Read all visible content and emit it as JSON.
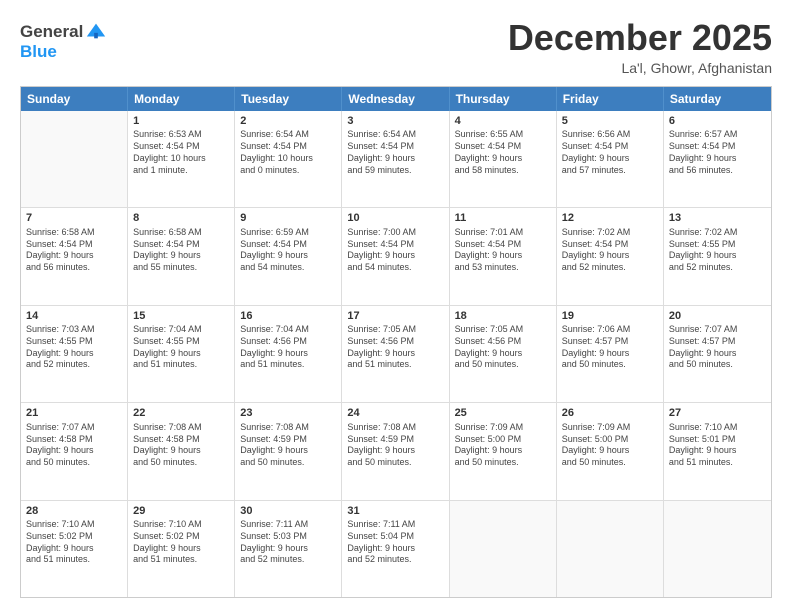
{
  "logo": {
    "general": "General",
    "blue": "Blue"
  },
  "header": {
    "month": "December 2025",
    "location": "La'l, Ghowr, Afghanistan"
  },
  "days": [
    "Sunday",
    "Monday",
    "Tuesday",
    "Wednesday",
    "Thursday",
    "Friday",
    "Saturday"
  ],
  "rows": [
    [
      {
        "day": "",
        "lines": []
      },
      {
        "day": "1",
        "lines": [
          "Sunrise: 6:53 AM",
          "Sunset: 4:54 PM",
          "Daylight: 10 hours",
          "and 1 minute."
        ]
      },
      {
        "day": "2",
        "lines": [
          "Sunrise: 6:54 AM",
          "Sunset: 4:54 PM",
          "Daylight: 10 hours",
          "and 0 minutes."
        ]
      },
      {
        "day": "3",
        "lines": [
          "Sunrise: 6:54 AM",
          "Sunset: 4:54 PM",
          "Daylight: 9 hours",
          "and 59 minutes."
        ]
      },
      {
        "day": "4",
        "lines": [
          "Sunrise: 6:55 AM",
          "Sunset: 4:54 PM",
          "Daylight: 9 hours",
          "and 58 minutes."
        ]
      },
      {
        "day": "5",
        "lines": [
          "Sunrise: 6:56 AM",
          "Sunset: 4:54 PM",
          "Daylight: 9 hours",
          "and 57 minutes."
        ]
      },
      {
        "day": "6",
        "lines": [
          "Sunrise: 6:57 AM",
          "Sunset: 4:54 PM",
          "Daylight: 9 hours",
          "and 56 minutes."
        ]
      }
    ],
    [
      {
        "day": "7",
        "lines": [
          "Sunrise: 6:58 AM",
          "Sunset: 4:54 PM",
          "Daylight: 9 hours",
          "and 56 minutes."
        ]
      },
      {
        "day": "8",
        "lines": [
          "Sunrise: 6:58 AM",
          "Sunset: 4:54 PM",
          "Daylight: 9 hours",
          "and 55 minutes."
        ]
      },
      {
        "day": "9",
        "lines": [
          "Sunrise: 6:59 AM",
          "Sunset: 4:54 PM",
          "Daylight: 9 hours",
          "and 54 minutes."
        ]
      },
      {
        "day": "10",
        "lines": [
          "Sunrise: 7:00 AM",
          "Sunset: 4:54 PM",
          "Daylight: 9 hours",
          "and 54 minutes."
        ]
      },
      {
        "day": "11",
        "lines": [
          "Sunrise: 7:01 AM",
          "Sunset: 4:54 PM",
          "Daylight: 9 hours",
          "and 53 minutes."
        ]
      },
      {
        "day": "12",
        "lines": [
          "Sunrise: 7:02 AM",
          "Sunset: 4:54 PM",
          "Daylight: 9 hours",
          "and 52 minutes."
        ]
      },
      {
        "day": "13",
        "lines": [
          "Sunrise: 7:02 AM",
          "Sunset: 4:55 PM",
          "Daylight: 9 hours",
          "and 52 minutes."
        ]
      }
    ],
    [
      {
        "day": "14",
        "lines": [
          "Sunrise: 7:03 AM",
          "Sunset: 4:55 PM",
          "Daylight: 9 hours",
          "and 52 minutes."
        ]
      },
      {
        "day": "15",
        "lines": [
          "Sunrise: 7:04 AM",
          "Sunset: 4:55 PM",
          "Daylight: 9 hours",
          "and 51 minutes."
        ]
      },
      {
        "day": "16",
        "lines": [
          "Sunrise: 7:04 AM",
          "Sunset: 4:56 PM",
          "Daylight: 9 hours",
          "and 51 minutes."
        ]
      },
      {
        "day": "17",
        "lines": [
          "Sunrise: 7:05 AM",
          "Sunset: 4:56 PM",
          "Daylight: 9 hours",
          "and 51 minutes."
        ]
      },
      {
        "day": "18",
        "lines": [
          "Sunrise: 7:05 AM",
          "Sunset: 4:56 PM",
          "Daylight: 9 hours",
          "and 50 minutes."
        ]
      },
      {
        "day": "19",
        "lines": [
          "Sunrise: 7:06 AM",
          "Sunset: 4:57 PM",
          "Daylight: 9 hours",
          "and 50 minutes."
        ]
      },
      {
        "day": "20",
        "lines": [
          "Sunrise: 7:07 AM",
          "Sunset: 4:57 PM",
          "Daylight: 9 hours",
          "and 50 minutes."
        ]
      }
    ],
    [
      {
        "day": "21",
        "lines": [
          "Sunrise: 7:07 AM",
          "Sunset: 4:58 PM",
          "Daylight: 9 hours",
          "and 50 minutes."
        ]
      },
      {
        "day": "22",
        "lines": [
          "Sunrise: 7:08 AM",
          "Sunset: 4:58 PM",
          "Daylight: 9 hours",
          "and 50 minutes."
        ]
      },
      {
        "day": "23",
        "lines": [
          "Sunrise: 7:08 AM",
          "Sunset: 4:59 PM",
          "Daylight: 9 hours",
          "and 50 minutes."
        ]
      },
      {
        "day": "24",
        "lines": [
          "Sunrise: 7:08 AM",
          "Sunset: 4:59 PM",
          "Daylight: 9 hours",
          "and 50 minutes."
        ]
      },
      {
        "day": "25",
        "lines": [
          "Sunrise: 7:09 AM",
          "Sunset: 5:00 PM",
          "Daylight: 9 hours",
          "and 50 minutes."
        ]
      },
      {
        "day": "26",
        "lines": [
          "Sunrise: 7:09 AM",
          "Sunset: 5:00 PM",
          "Daylight: 9 hours",
          "and 50 minutes."
        ]
      },
      {
        "day": "27",
        "lines": [
          "Sunrise: 7:10 AM",
          "Sunset: 5:01 PM",
          "Daylight: 9 hours",
          "and 51 minutes."
        ]
      }
    ],
    [
      {
        "day": "28",
        "lines": [
          "Sunrise: 7:10 AM",
          "Sunset: 5:02 PM",
          "Daylight: 9 hours",
          "and 51 minutes."
        ]
      },
      {
        "day": "29",
        "lines": [
          "Sunrise: 7:10 AM",
          "Sunset: 5:02 PM",
          "Daylight: 9 hours",
          "and 51 minutes."
        ]
      },
      {
        "day": "30",
        "lines": [
          "Sunrise: 7:11 AM",
          "Sunset: 5:03 PM",
          "Daylight: 9 hours",
          "and 52 minutes."
        ]
      },
      {
        "day": "31",
        "lines": [
          "Sunrise: 7:11 AM",
          "Sunset: 5:04 PM",
          "Daylight: 9 hours",
          "and 52 minutes."
        ]
      },
      {
        "day": "",
        "lines": []
      },
      {
        "day": "",
        "lines": []
      },
      {
        "day": "",
        "lines": []
      }
    ]
  ]
}
